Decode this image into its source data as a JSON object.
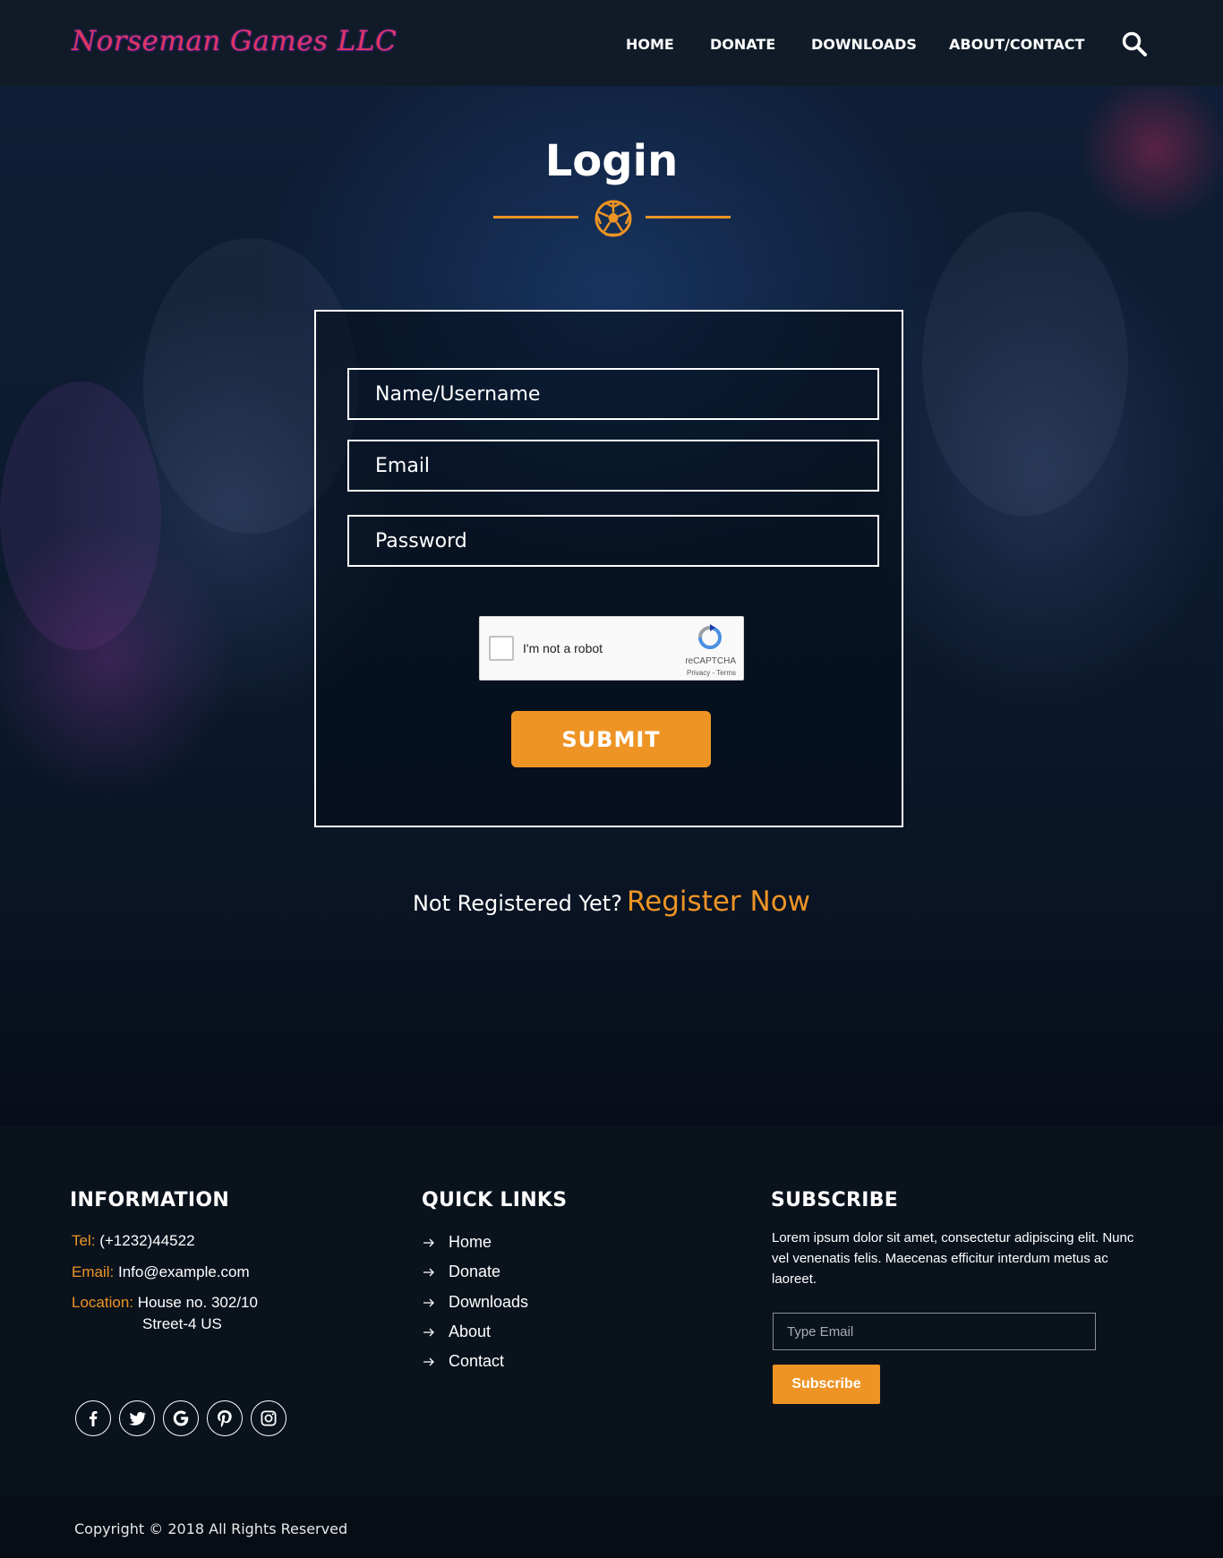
{
  "header": {
    "logo_text": "Norseman Games LLC",
    "nav": [
      "HOME",
      "DONATE",
      "DOWNLOADS",
      "ABOUT/CONTACT"
    ],
    "search_icon": "search-icon"
  },
  "hero": {
    "title": "Login",
    "divider_icon": "soccer-ball-icon",
    "form": {
      "username_placeholder": "Name/Username",
      "email_placeholder": "Email",
      "password_placeholder": "Password",
      "captcha_label": "I'm not a robot",
      "captcha_brand": "reCAPTCHA",
      "captcha_terms": "Privacy - Terms",
      "submit_label": "SUBMIT"
    },
    "register_question": "Not Registered Yet?",
    "register_link": "Register Now"
  },
  "footer": {
    "information": {
      "title": "INFORMATION",
      "tel_label": "Tel:",
      "tel_value": "(+1232)44522",
      "email_label": "Email:",
      "email_value": "Info@example.com",
      "location_label": "Location:",
      "location_line1": "House no. 302/10",
      "location_line2": "Street-4 US",
      "social_icons": [
        "facebook-icon",
        "twitter-icon",
        "google-icon",
        "pinterest-icon",
        "instagram-icon"
      ]
    },
    "quick_links": {
      "title": "QUICK LINKS",
      "items": [
        "Home",
        "Donate",
        "Downloads",
        "About",
        "Contact"
      ]
    },
    "subscribe": {
      "title": "SUBSCRIBE",
      "text": "Lorem ipsum dolor sit amet, consectetur adipiscing elit. Nunc vel venenatis felis. Maecenas efficitur interdum metus ac laoreet.",
      "email_placeholder": "Type Email",
      "button_label": "Subscribe"
    },
    "copyright": "Copyright © 2018 All Rights Reserved"
  },
  "colors": {
    "accent": "#ee9425",
    "header_bg": "#111b28",
    "footer_bg": "#0a121c"
  }
}
